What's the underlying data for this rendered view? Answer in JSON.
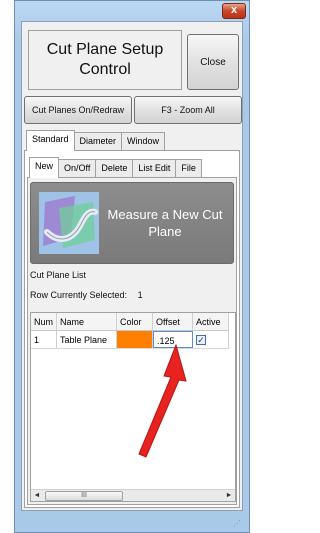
{
  "window": {
    "close_glyph": "x"
  },
  "header": {
    "title": "Cut Plane Setup Control",
    "close_label": "Close"
  },
  "toolbar": {
    "cut_planes_label": "Cut Planes On/Redraw",
    "zoom_label": "F3 - Zoom All"
  },
  "tabs": [
    {
      "label": "Standard",
      "active": true
    },
    {
      "label": "Diameter",
      "active": false
    },
    {
      "label": "Window",
      "active": false
    }
  ],
  "subtabs": [
    {
      "label": "New",
      "active": true
    },
    {
      "label": "On/Off",
      "active": false
    },
    {
      "label": "Delete",
      "active": false
    },
    {
      "label": "List Edit",
      "active": false
    },
    {
      "label": "File",
      "active": false
    }
  ],
  "measure": {
    "label": "Measure a New Cut Plane",
    "icon": "cut-plane-graphic-icon"
  },
  "list": {
    "title": "Cut Plane List",
    "row_selected_label": "Row Currently Selected:",
    "row_selected_value": "1"
  },
  "table": {
    "headers": [
      "Num",
      "Name",
      "Color",
      "Offset",
      "Active"
    ],
    "rows": [
      {
        "num": "1",
        "name": "Table Plane",
        "color": "#ff7f00",
        "offset": ".125",
        "active": true
      }
    ]
  },
  "scrollbar": {
    "left_arrow": "◄",
    "right_arrow": "►",
    "thumb_grip": "III"
  },
  "annotation": {
    "arrow_color": "#e8231f"
  }
}
